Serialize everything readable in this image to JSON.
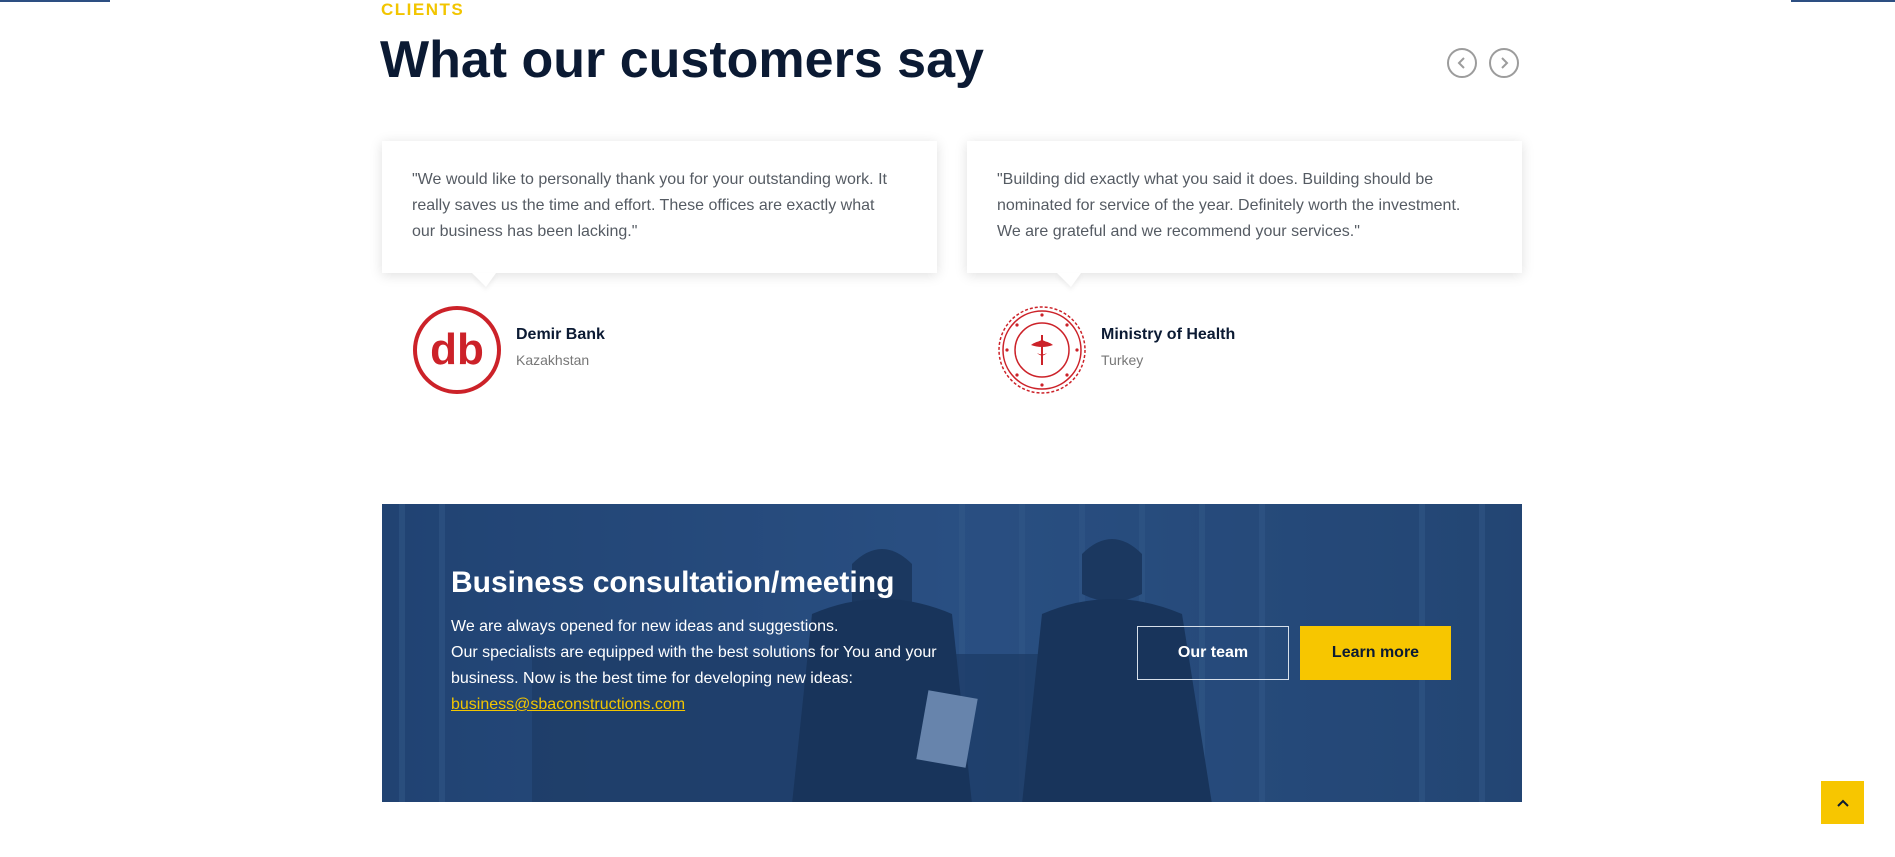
{
  "section": {
    "eyebrow": "CLIENTS",
    "title": "What our customers say",
    "prev_icon": "chevron-left-icon",
    "next_icon": "chevron-right-icon"
  },
  "testimonials": [
    {
      "quote_lines": [
        "\"We would like to personally thank you for your outstanding work. It",
        "really saves us the time and effort. These offices are exactly what",
        "our business has been lacking.\""
      ],
      "client_name": "Demir Bank",
      "client_country": "Kazakhstan",
      "logo_text": "db",
      "logo_icon": "demir-bank-logo"
    },
    {
      "quote_lines": [
        "\"Building did exactly what you said it does. Building should be",
        "nominated for service of the year. Definitely worth the investment.",
        "We are grateful and we recommend your services.\""
      ],
      "client_name": "Ministry of Health",
      "client_country": "Turkey",
      "logo_icon": "ministry-of-health-seal"
    }
  ],
  "banner": {
    "title": "Business consultation/meeting",
    "lines": [
      "We are always opened for new ideas and suggestions.",
      "Our specialists are equipped with the best solutions for You and your",
      "business. Now is the best time for developing new ideas:"
    ],
    "email": "business@sbaconstructions.com",
    "btn_outline": "Our team",
    "btn_solid": "Learn more"
  },
  "back_to_top_icon": "chevron-up-icon",
  "colors": {
    "accent": "#f7c600",
    "heading": "#0b1a33",
    "banner_overlay": "#264a7c",
    "logo_red": "#cc2229"
  }
}
